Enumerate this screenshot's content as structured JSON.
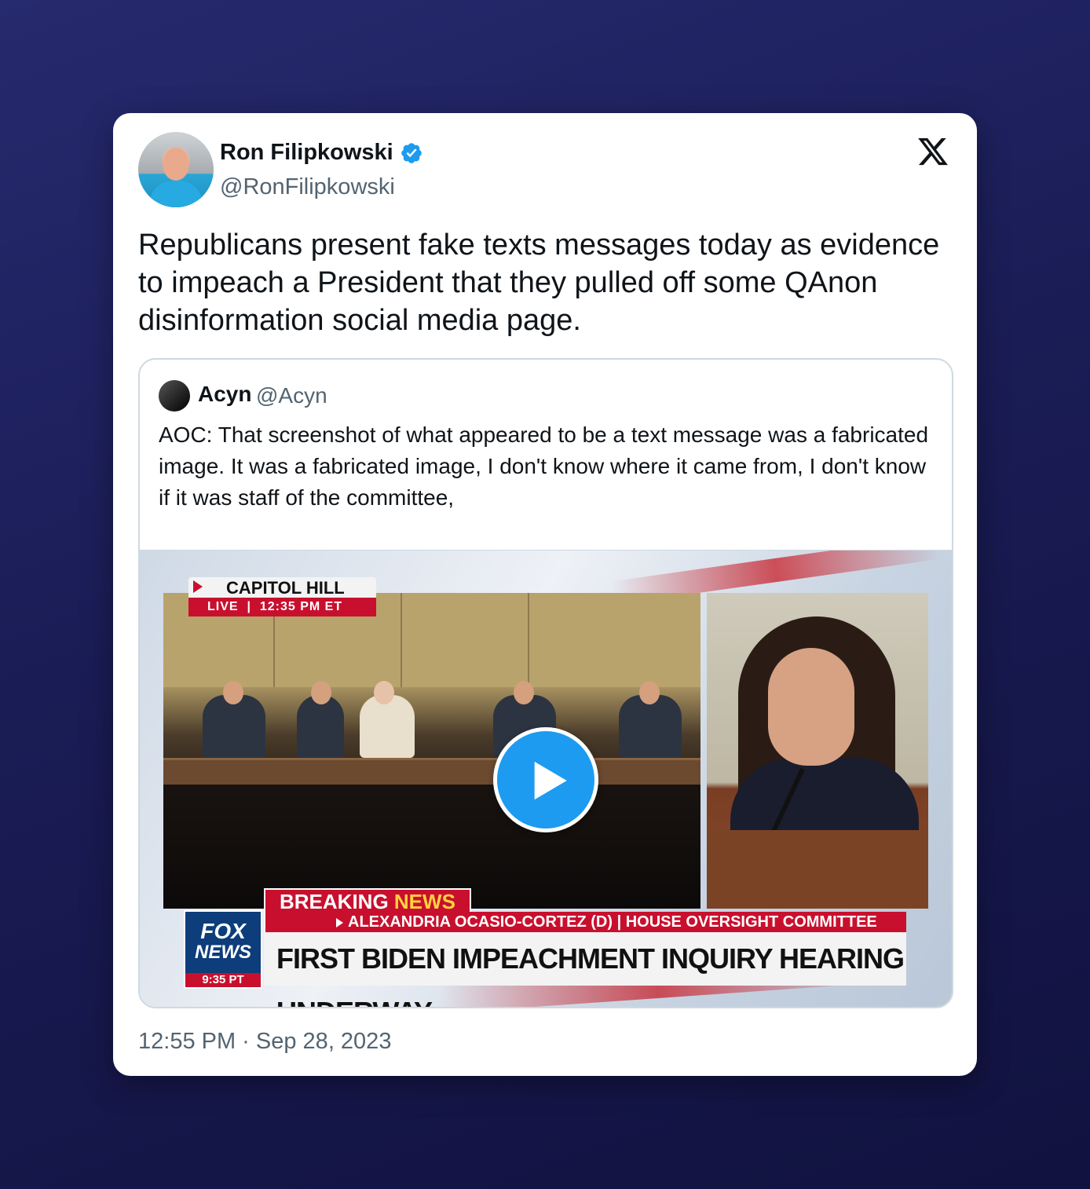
{
  "author": {
    "name": "Ron Filipkowski",
    "handle": "@RonFilipkowski",
    "verified": true
  },
  "tweet_text": "Republicans present fake texts messages today as evidence to impeach a President that they pulled off some QAnon disinformation social media page.",
  "quoted": {
    "name": "Acyn",
    "handle": "@Acyn",
    "text": "AOC: That screenshot of what appeared to be a text message was a fabricated image. It was a fabricated image, I don't know where it came from, I don't know if it was staff of the committee,",
    "video": {
      "location_tag": "CAPITOL HILL",
      "live_label": "LIVE",
      "live_time": "12:35 PM ET",
      "breaking_word1": "BREAKING",
      "breaking_word2": "NEWS",
      "subtitle": "ALEXANDRIA OCASIO-CORTEZ (D) | HOUSE OVERSIGHT COMMITTEE",
      "headline": "FIRST BIDEN IMPEACHMENT INQUIRY HEARING UNDERWAY",
      "network_line1": "FOX",
      "network_line2": "NEWS",
      "network_time": "9:35 PT"
    }
  },
  "timestamp": "12:55 PM · Sep 28, 2023",
  "colors": {
    "background": "#1a1c55",
    "accent": "#1d9bf0",
    "fox_red": "#c8102e"
  },
  "icons": {
    "verified": "verified-badge-icon",
    "platform": "x-logo-icon",
    "play": "play-icon"
  }
}
